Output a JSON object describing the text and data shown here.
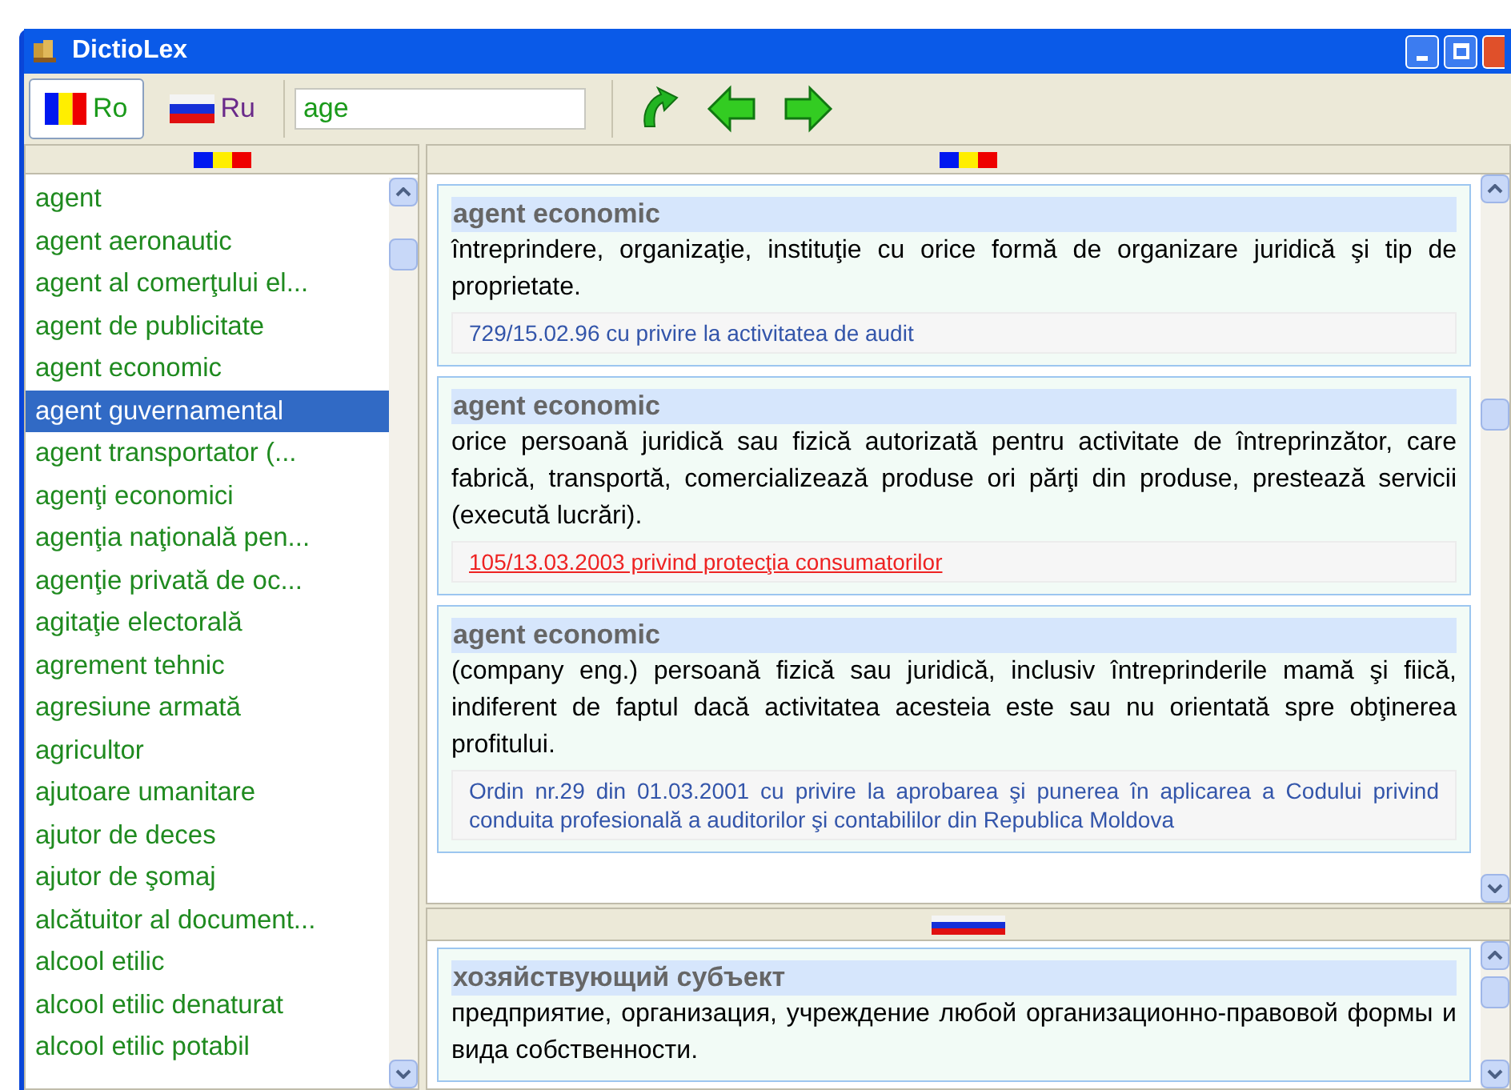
{
  "window": {
    "title": "DictioLex"
  },
  "toolbar": {
    "languages": [
      {
        "label": "Ro",
        "kind": "ro",
        "selected": true
      },
      {
        "label": "Ru",
        "kind": "ru",
        "selected": false
      }
    ],
    "search": {
      "value": "age"
    }
  },
  "word_list": {
    "items": [
      {
        "label": "agent",
        "selected": false
      },
      {
        "label": "agent aeronautic",
        "selected": false
      },
      {
        "label": "agent al comerţului el...",
        "selected": false
      },
      {
        "label": "agent de publicitate",
        "selected": false
      },
      {
        "label": "agent economic",
        "selected": false
      },
      {
        "label": "agent guvernamental",
        "selected": true
      },
      {
        "label": "agent transportator (...",
        "selected": false
      },
      {
        "label": "agenţi economici",
        "selected": false
      },
      {
        "label": "agenţia naţională pen...",
        "selected": false
      },
      {
        "label": "agenţie privată de oc...",
        "selected": false
      },
      {
        "label": "agitaţie electorală",
        "selected": false
      },
      {
        "label": "agrement tehnic",
        "selected": false
      },
      {
        "label": "agresiune armată",
        "selected": false
      },
      {
        "label": "agricultor",
        "selected": false
      },
      {
        "label": "ajutoare umanitare",
        "selected": false
      },
      {
        "label": "ajutor de deces",
        "selected": false
      },
      {
        "label": "ajutor de şomaj",
        "selected": false
      },
      {
        "label": "alcătuitor al document...",
        "selected": false
      },
      {
        "label": "alcool etilic",
        "selected": false
      },
      {
        "label": "alcool etilic denaturat",
        "selected": false
      },
      {
        "label": "alcool etilic potabil",
        "selected": false
      }
    ]
  },
  "romanian_pane": {
    "entries": [
      {
        "term": "agent economic",
        "definition": "întreprindere, organizaţie, instituţie cu orice formă de organizare juridică şi tip de proprietate.",
        "reference": {
          "text": "729/15.02.96 cu privire la activitatea de audit",
          "highlighted": false
        }
      },
      {
        "term": "agent economic",
        "definition": "orice persoană juridică sau fizică autorizată pentru activitate de întreprinzător, care fabrică, transportă, comercializează produse ori părţi din produse, prestează servicii (execută lucrări).",
        "reference": {
          "text": "105/13.03.2003 privind protecţia consumatorilor",
          "highlighted": true
        }
      },
      {
        "term": "agent economic",
        "definition": "(company eng.) persoană fizică sau juridică, inclusiv întreprinderile mamă şi fiică, indiferent de faptul dacă activitatea acesteia este sau nu orientată spre obţinerea profitului.",
        "reference": {
          "text": "Ordin nr.29 din 01.03.2001 cu privire la aprobarea şi punerea în aplicarea a Codului privind conduita profesională a auditorilor şi contabililor din Republica Moldova",
          "highlighted": false
        }
      }
    ]
  },
  "russian_pane": {
    "entries": [
      {
        "term": "хозяйствующий субъект",
        "definition": "предприятие, организация, учреждение любой организационно-правовой формы и вида собственности."
      }
    ]
  }
}
